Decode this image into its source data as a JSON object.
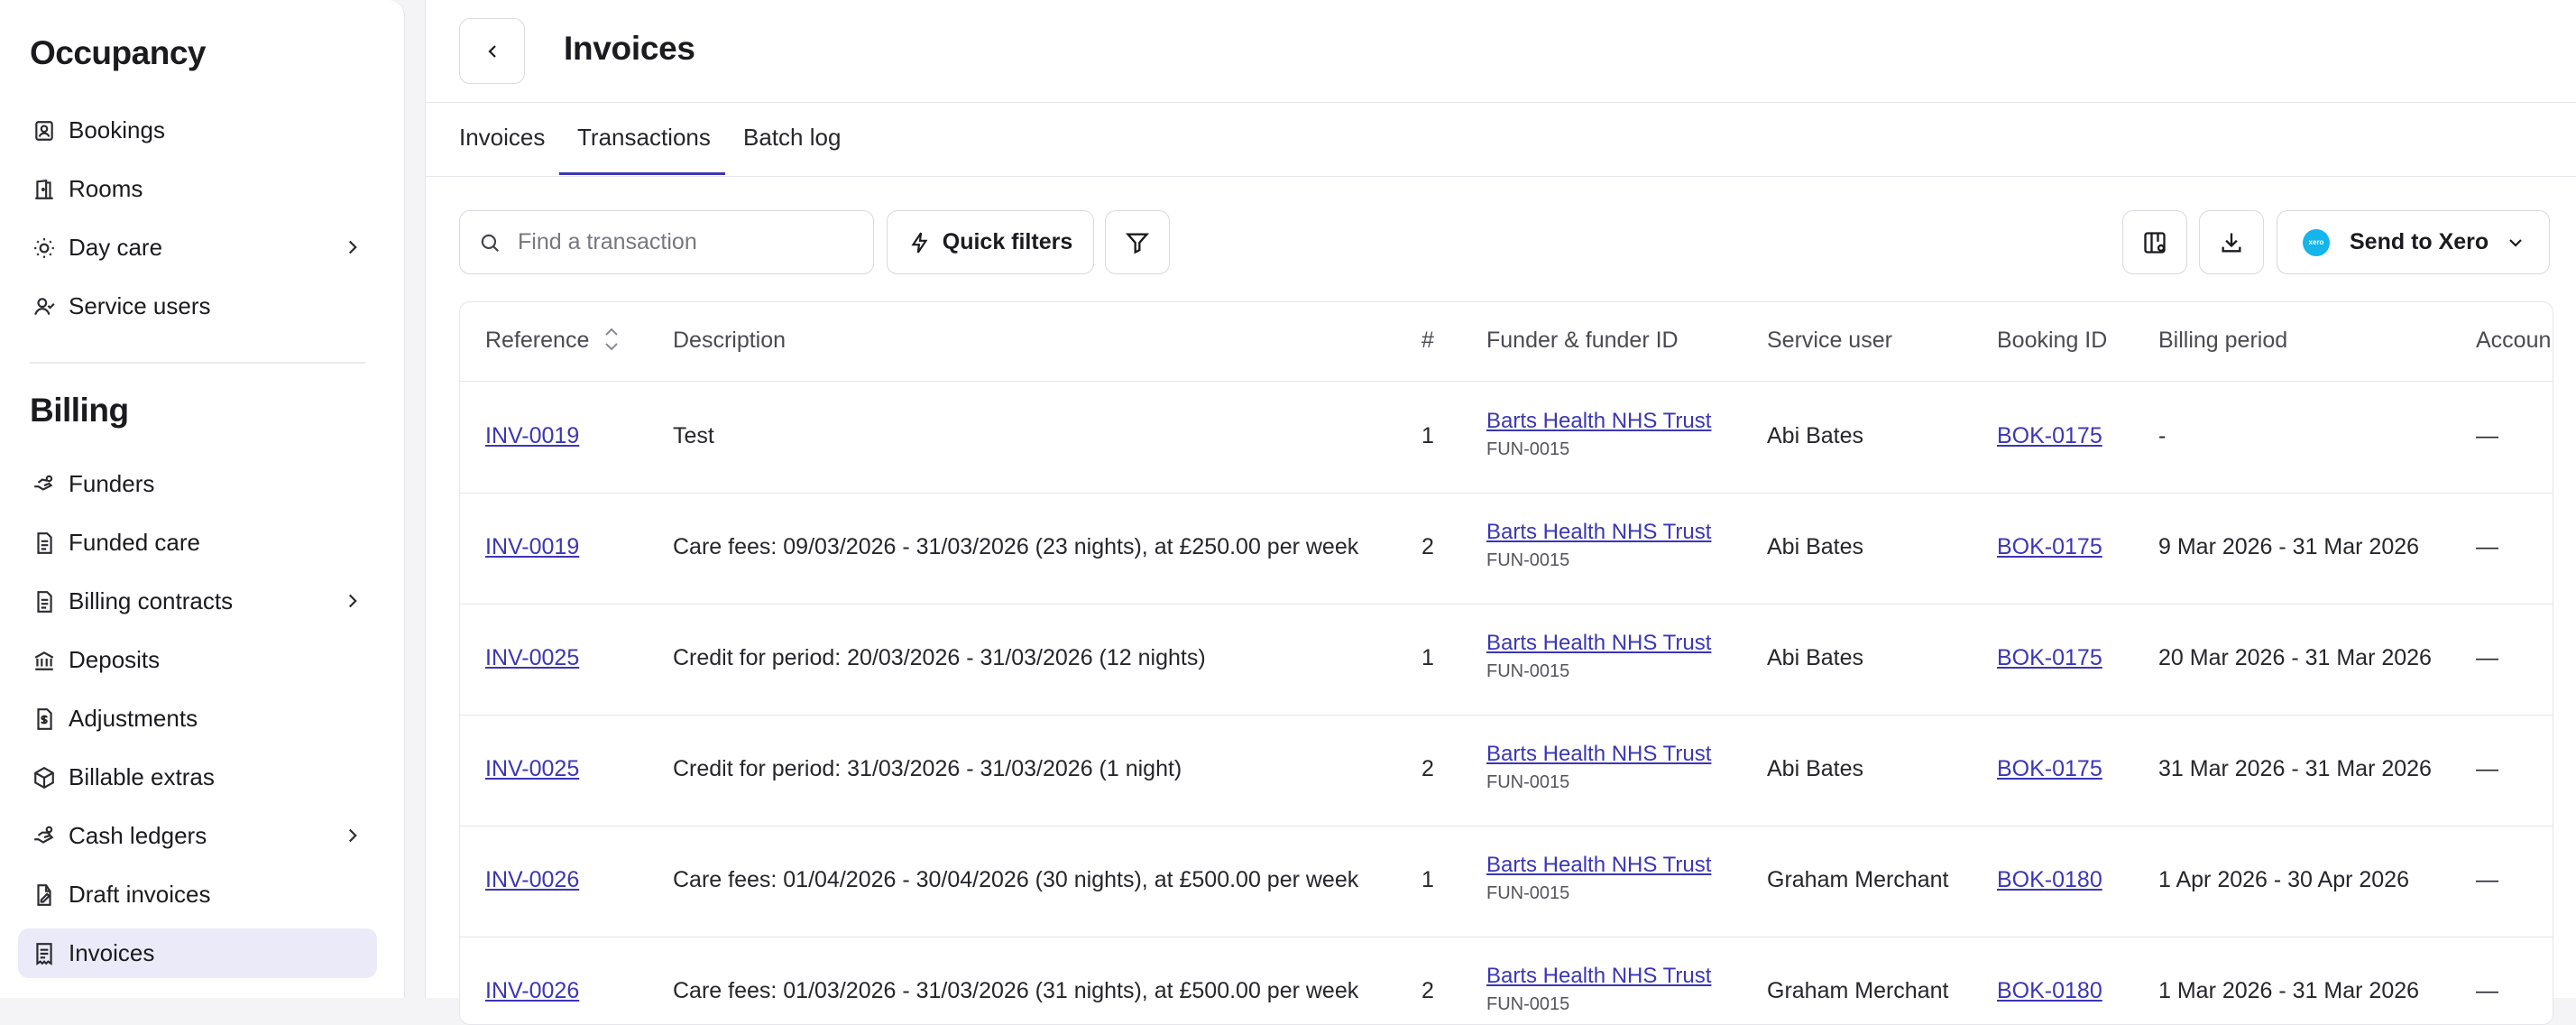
{
  "sidebar": {
    "occupancy": {
      "title": "Occupancy",
      "items": [
        {
          "label": "Bookings",
          "icon": "bookings-icon"
        },
        {
          "label": "Rooms",
          "icon": "rooms-icon"
        },
        {
          "label": "Day care",
          "icon": "sun-icon",
          "has_chevron": true
        },
        {
          "label": "Service users",
          "icon": "service-users-icon"
        }
      ]
    },
    "billing": {
      "title": "Billing",
      "items": [
        {
          "label": "Funders",
          "icon": "funders-icon"
        },
        {
          "label": "Funded care",
          "icon": "document-icon"
        },
        {
          "label": "Billing contracts",
          "icon": "document-icon",
          "has_chevron": true
        },
        {
          "label": "Deposits",
          "icon": "bank-icon"
        },
        {
          "label": "Adjustments",
          "icon": "adjustments-icon"
        },
        {
          "label": "Billable extras",
          "icon": "box-icon"
        },
        {
          "label": "Cash ledgers",
          "icon": "cash-icon",
          "has_chevron": true
        },
        {
          "label": "Draft invoices",
          "icon": "draft-icon"
        },
        {
          "label": "Invoices",
          "icon": "invoice-icon",
          "active": true
        }
      ]
    }
  },
  "header": {
    "title": "Invoices"
  },
  "tabs": [
    {
      "label": "Invoices"
    },
    {
      "label": "Transactions",
      "active": true
    },
    {
      "label": "Batch log"
    }
  ],
  "toolbar": {
    "search_placeholder": "Find a transaction",
    "quick_filters_label": "Quick filters",
    "send_to_xero_label": "Send to Xero",
    "xero_logo_text": "xero"
  },
  "table": {
    "columns": [
      "Reference",
      "Description",
      "#",
      "Funder & funder ID",
      "Service user",
      "Booking ID",
      "Billing period",
      "Accoun"
    ],
    "rows": [
      {
        "reference": "INV-0019",
        "description": "Test",
        "num": "1",
        "funder": "Barts Health NHS Trust",
        "funder_id": "FUN-0015",
        "service_user": "Abi Bates",
        "booking_id": "BOK-0175",
        "billing_period": "-",
        "account": "—"
      },
      {
        "reference": "INV-0019",
        "description": "Care fees: 09/03/2026 - 31/03/2026 (23 nights), at £250.00 per week",
        "num": "2",
        "funder": "Barts Health NHS Trust",
        "funder_id": "FUN-0015",
        "service_user": "Abi Bates",
        "booking_id": "BOK-0175",
        "billing_period": "9 Mar 2026 - 31 Mar 2026",
        "account": "—"
      },
      {
        "reference": "INV-0025",
        "description": "Credit for period: 20/03/2026 - 31/03/2026 (12 nights)",
        "num": "1",
        "funder": "Barts Health NHS Trust",
        "funder_id": "FUN-0015",
        "service_user": "Abi Bates",
        "booking_id": "BOK-0175",
        "billing_period": "20 Mar 2026 - 31 Mar 2026",
        "account": "—"
      },
      {
        "reference": "INV-0025",
        "description": "Credit for period: 31/03/2026 - 31/03/2026 (1 night)",
        "num": "2",
        "funder": "Barts Health NHS Trust",
        "funder_id": "FUN-0015",
        "service_user": "Abi Bates",
        "booking_id": "BOK-0175",
        "billing_period": "31 Mar 2026 - 31 Mar 2026",
        "account": "—"
      },
      {
        "reference": "INV-0026",
        "description": "Care fees: 01/04/2026 - 30/04/2026 (30 nights), at £500.00 per week",
        "num": "1",
        "funder": "Barts Health NHS Trust",
        "funder_id": "FUN-0015",
        "service_user": "Graham Merchant",
        "booking_id": "BOK-0180",
        "billing_period": "1 Apr 2026 - 30 Apr 2026",
        "account": "—"
      },
      {
        "reference": "INV-0026",
        "description": "Care fees: 01/03/2026 - 31/03/2026 (31 nights), at £500.00 per week",
        "num": "2",
        "funder": "Barts Health NHS Trust",
        "funder_id": "FUN-0015",
        "service_user": "Graham Merchant",
        "booking_id": "BOK-0180",
        "billing_period": "1 Mar 2026 - 31 Mar 2026",
        "account": "—"
      }
    ]
  },
  "colors": {
    "accent": "#3b36b5",
    "active_nav_bg": "#ebeaf8",
    "xero_blue": "#13b5ea"
  }
}
